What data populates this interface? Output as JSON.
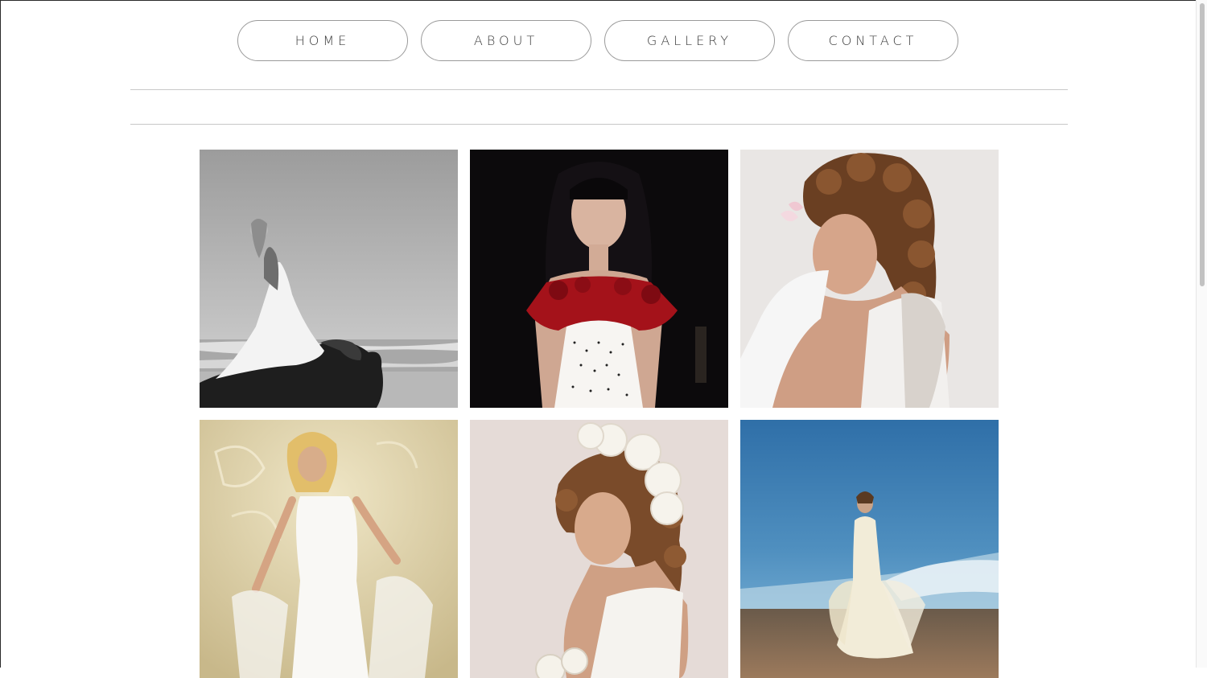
{
  "nav": {
    "items": [
      {
        "label": "HOME"
      },
      {
        "label": "ABOUT"
      },
      {
        "label": "GALLERY"
      },
      {
        "label": "CONTACT"
      }
    ]
  },
  "gallery": {
    "photos": [
      {
        "subject": "bride-on-rock-by-sea-bw"
      },
      {
        "subject": "bride-red-rose-bodice"
      },
      {
        "subject": "bride-curly-hair-lace"
      },
      {
        "subject": "bride-against-textured-wall"
      },
      {
        "subject": "bride-white-flowers-in-hair"
      },
      {
        "subject": "bride-on-beach-blue-sky"
      }
    ]
  },
  "colors": {
    "text": "#3a3a3a",
    "border": "#9a9a9a",
    "rule": "#c8c8c8"
  }
}
